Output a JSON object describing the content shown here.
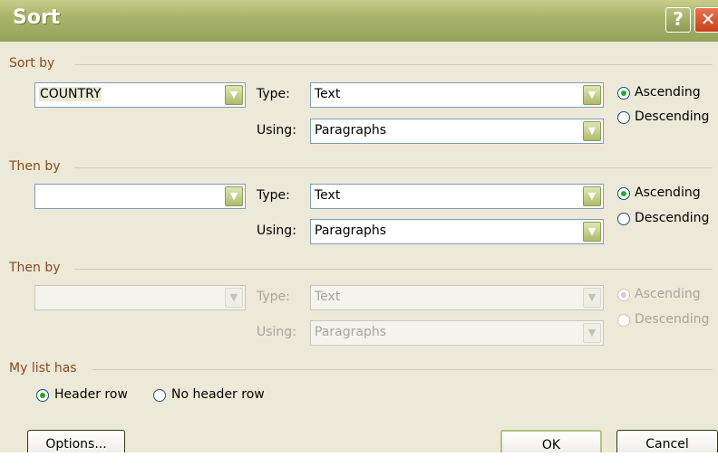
{
  "window": {
    "title": "Sort",
    "help_glyph": "?",
    "close_glyph": "✕"
  },
  "sort_by": {
    "label": "Sort by",
    "column": "COUNTRY",
    "type_label": "Type:",
    "type_value": "Text",
    "using_label": "Using:",
    "using_value": "Paragraphs",
    "ascending": "Ascending",
    "descending": "Descending",
    "order": "ascending"
  },
  "then_by_1": {
    "label": "Then by",
    "column": "",
    "type_label": "Type:",
    "type_value": "Text",
    "using_label": "Using:",
    "using_value": "Paragraphs",
    "ascending": "Ascending",
    "descending": "Descending",
    "order": "ascending"
  },
  "then_by_2": {
    "label": "Then by",
    "column": "",
    "type_label": "Type:",
    "type_value": "Text",
    "using_label": "Using:",
    "using_value": "Paragraphs",
    "ascending": "Ascending",
    "descending": "Descending",
    "order": "ascending",
    "enabled": false
  },
  "list_has": {
    "label": "My list has",
    "header_row": "Header row",
    "no_header_row": "No header row",
    "selected": "header_row"
  },
  "buttons": {
    "options": "Options...",
    "ok": "OK",
    "cancel": "Cancel"
  },
  "icons": {
    "dropdown": "chevron-down-icon",
    "help": "help-icon",
    "close": "close-icon"
  },
  "colors": {
    "section_label": "#8a4a1e",
    "titlebar": "#a8b46a",
    "radio_dot": "#22a82a"
  }
}
